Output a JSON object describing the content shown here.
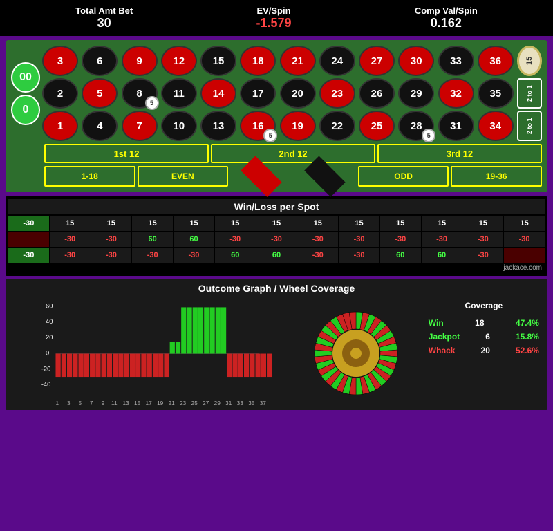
{
  "header": {
    "total_amt_bet_label": "Total Amt Bet",
    "total_amt_bet_value": "30",
    "ev_spin_label": "EV/Spin",
    "ev_spin_value": "-1.579",
    "comp_val_label": "Comp Val/Spin",
    "comp_val_value": "0.162"
  },
  "table": {
    "zeros": [
      "00",
      "0"
    ],
    "numbers": [
      {
        "n": "3",
        "c": "red"
      },
      {
        "n": "6",
        "c": "black"
      },
      {
        "n": "9",
        "c": "red"
      },
      {
        "n": "12",
        "c": "red"
      },
      {
        "n": "15",
        "c": "black"
      },
      {
        "n": "18",
        "c": "red"
      },
      {
        "n": "21",
        "c": "red"
      },
      {
        "n": "24",
        "c": "black"
      },
      {
        "n": "27",
        "c": "red"
      },
      {
        "n": "30",
        "c": "red"
      },
      {
        "n": "33",
        "c": "black"
      },
      {
        "n": "36",
        "c": "red"
      },
      {
        "n": "2",
        "c": "black"
      },
      {
        "n": "5",
        "c": "red"
      },
      {
        "n": "8",
        "c": "black",
        "chip": "5"
      },
      {
        "n": "11",
        "c": "black"
      },
      {
        "n": "14",
        "c": "red"
      },
      {
        "n": "17",
        "c": "black"
      },
      {
        "n": "20",
        "c": "black"
      },
      {
        "n": "23",
        "c": "red"
      },
      {
        "n": "26",
        "c": "black"
      },
      {
        "n": "29",
        "c": "black"
      },
      {
        "n": "32",
        "c": "red"
      },
      {
        "n": "35",
        "c": "black"
      },
      {
        "n": "1",
        "c": "red"
      },
      {
        "n": "4",
        "c": "black"
      },
      {
        "n": "7",
        "c": "red"
      },
      {
        "n": "10",
        "c": "black"
      },
      {
        "n": "13",
        "c": "black"
      },
      {
        "n": "16",
        "c": "red",
        "chip": "5"
      },
      {
        "n": "19",
        "c": "red"
      },
      {
        "n": "22",
        "c": "black"
      },
      {
        "n": "25",
        "c": "red"
      },
      {
        "n": "28",
        "c": "black",
        "chip": "5"
      },
      {
        "n": "31",
        "c": "black"
      },
      {
        "n": "34",
        "c": "red"
      }
    ],
    "dozens": [
      "1st 12",
      "2nd 12",
      "3rd 12"
    ],
    "outside": [
      "1-18",
      "EVEN",
      "ODD",
      "19-36"
    ],
    "two_to_one": [
      "2 to 1",
      "2 to 1"
    ],
    "top_chip_value": "15"
  },
  "win_loss": {
    "title": "Win/Loss per Spot",
    "row1": [
      "-30",
      "15",
      "15",
      "15",
      "15",
      "15",
      "15",
      "15",
      "15",
      "15",
      "15",
      "15",
      "15"
    ],
    "row2": [
      "",
      "-30",
      "-30",
      "60",
      "60",
      "-30",
      "-30",
      "-30",
      "-30",
      "-30",
      "-30",
      "-30",
      "-30"
    ],
    "row3": [
      "-30",
      "-30",
      "-30",
      "-30",
      "-30",
      "60",
      "60",
      "-30",
      "-30",
      "60",
      "60",
      "-30",
      ""
    ]
  },
  "outcome": {
    "title": "Outcome Graph / Wheel Coverage",
    "coverage": {
      "title": "Coverage",
      "win_label": "Win",
      "win_value": "18",
      "win_pct": "47.4%",
      "jackpot_label": "Jackpot",
      "jackpot_value": "6",
      "jackpot_pct": "15.8%",
      "whack_label": "Whack",
      "whack_value": "20",
      "whack_pct": "52.6%"
    }
  },
  "credit": "jackace.com"
}
